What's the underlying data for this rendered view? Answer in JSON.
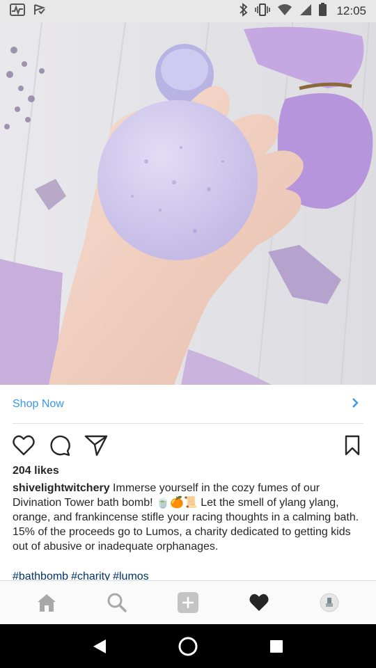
{
  "status_bar": {
    "time": "12:05",
    "left_icons": [
      "activity-icon",
      "check-flag-icon"
    ],
    "right_icons": [
      "bluetooth-icon",
      "vibrate-icon",
      "wifi-icon",
      "signal-icon",
      "battery-icon"
    ]
  },
  "post": {
    "shop_now_label": "Shop Now",
    "likes": "204 likes",
    "username": "shivelightwitchery",
    "caption_part1": " Immerse yourself in the cozy fumes of our Divination Tower bath bomb! ",
    "caption_emoji": "🍵🍊📜",
    "caption_part2": " Let the smell of ylang ylang, orange, and frankincense stifle your racing thoughts in a calming bath. 15% of the proceeds go to Lumos, a charity dedicated to getting kids out of abusive or inadequate orphanages.",
    "hashtags": [
      "#bathbomb",
      "#charity",
      "#lumos"
    ]
  },
  "bottom_nav": [
    "home-icon",
    "search-icon",
    "add-icon",
    "heart-icon",
    "profile-icon"
  ],
  "colors": {
    "link_blue": "#3897f0",
    "hashtag_blue": "#003569",
    "bath_bomb_lavender": "#cfc8ec"
  }
}
